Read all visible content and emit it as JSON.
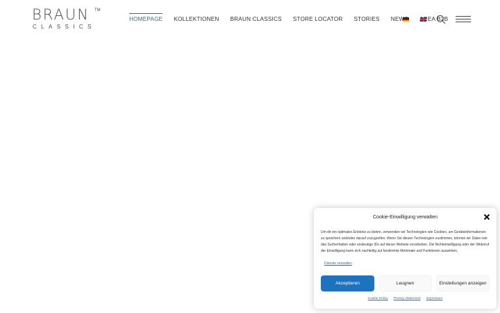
{
  "logo": {
    "top": "BRAUN",
    "bottom": "CLASSICS",
    "tm": "TM"
  },
  "nav": {
    "items": [
      {
        "label": "HOMEPAGE"
      },
      {
        "label": "KOLLEKTIONEN"
      },
      {
        "label": "BRAUN CLASSICS"
      },
      {
        "label": "STORE LOCATOR"
      },
      {
        "label": "STORIES"
      },
      {
        "label": "NEWS"
      },
      {
        "label": "AREA B2B"
      }
    ],
    "active": "HOMEPAGE"
  },
  "icons": {
    "flag_de": "german-flag-icon",
    "flag_en": "english-flag-icon",
    "search": "search-icon",
    "menu": "hamburger-menu-icon",
    "close": "close-icon"
  },
  "cookie": {
    "title": "Cookie-Einwilligung verwalten",
    "text": "Um dir ein optimales Erlebnis zu bieten, verwenden wir Technologien wie Cookies, um Geräteinformationen zu speichern und/oder darauf zuzugreifen. Wenn Sie diesen Technologien zustimmen, können wir Daten wie das Surfverhalten oder eindeutige IDs auf dieser Website verarbeiten. Die Nichteinwilligung oder der Widerruf der Einwilligung kann sich nachteilig auf bestimmte Merkmale und Funktionen auswirken.",
    "services_link": "Dienste verwalten",
    "accept": "Akzeptieren",
    "deny": "Leugnen",
    "settings": "Einstellungen anzeigen",
    "footer": [
      "Cookie Policy",
      "Privacy Statement",
      "Impressum"
    ]
  },
  "colors": {
    "accent": "#1e73be",
    "nav_active": "#3f6b7a"
  }
}
